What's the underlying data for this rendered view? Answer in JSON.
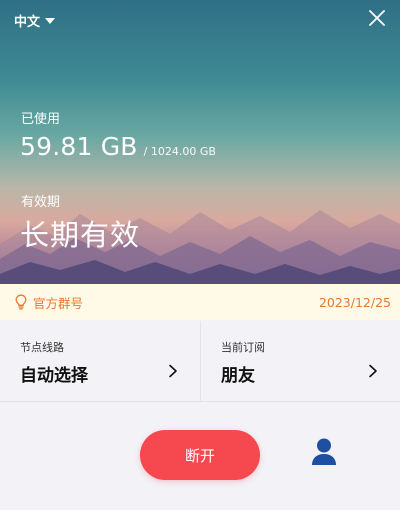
{
  "header": {
    "language_label": "中文",
    "icons": {
      "language_dropdown": "caret-down-icon",
      "close": "close-icon"
    }
  },
  "usage": {
    "used_label": "已使用",
    "used_value": "59.81 GB",
    "total_value": "/ 1024.00 GB"
  },
  "validity": {
    "label": "有效期",
    "value": "长期有效"
  },
  "notice": {
    "link_label": "官方群号",
    "date": "2023/12/25",
    "icon": "lightbulb-icon"
  },
  "cards": [
    {
      "label": "节点线路",
      "value": "自动选择"
    },
    {
      "label": "当前订阅",
      "value": "朋友"
    }
  ],
  "actions": {
    "disconnect_label": "断开",
    "user_icon": "user-icon"
  },
  "colors": {
    "accent_red": "#f5484f",
    "notice_orange": "#e9782a",
    "notice_bg": "#fff9e8",
    "user_icon_blue": "#1f4fa0"
  }
}
